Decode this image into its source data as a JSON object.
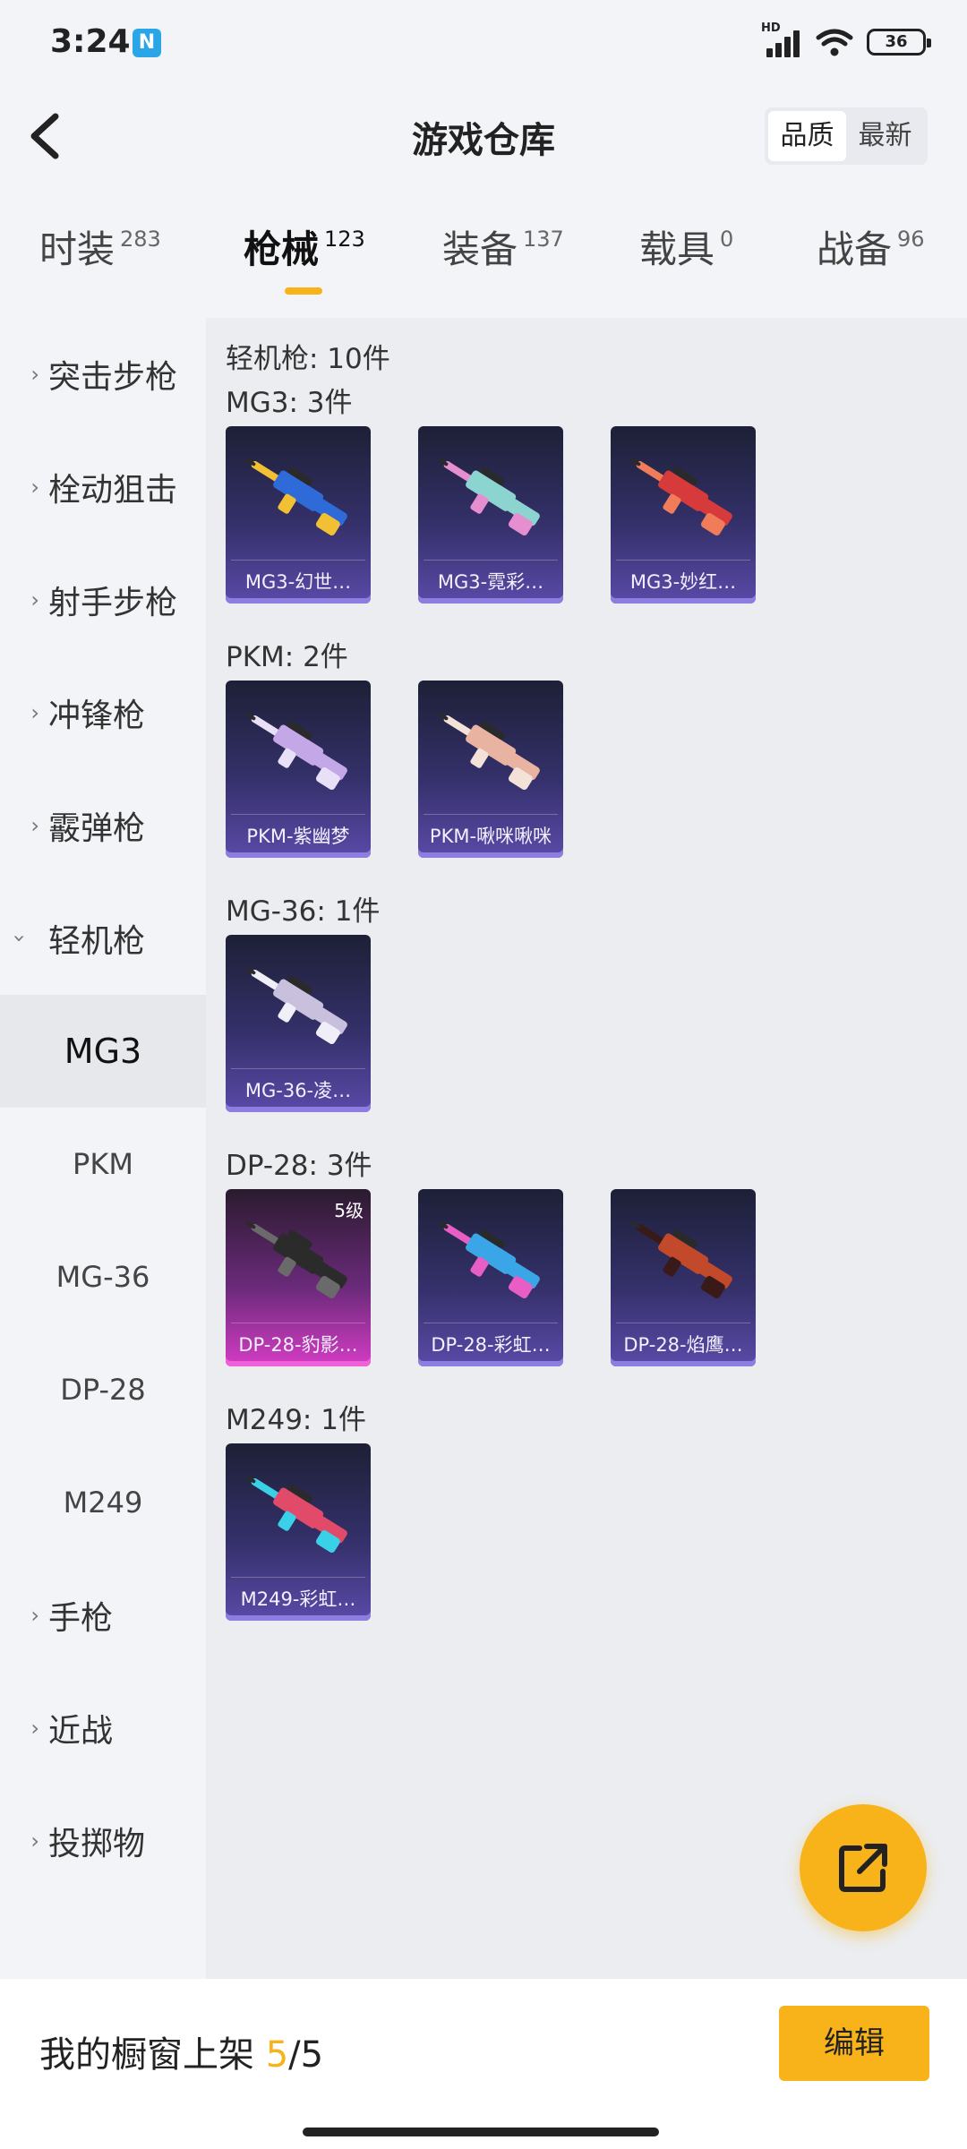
{
  "status_bar": {
    "time": "3:24",
    "battery": "36",
    "hd": "HD"
  },
  "header": {
    "title": "游戏仓库",
    "sort_options": [
      "品质",
      "最新"
    ],
    "active_sort": "品质"
  },
  "tabs": [
    {
      "label": "时装",
      "count": "283"
    },
    {
      "label": "枪械",
      "count": "123"
    },
    {
      "label": "装备",
      "count": "137"
    },
    {
      "label": "载具",
      "count": "0"
    },
    {
      "label": "战备",
      "count": "96"
    }
  ],
  "active_tab": "枪械",
  "sidebar": {
    "categories": [
      {
        "label": "突击步枪"
      },
      {
        "label": "栓动狙击"
      },
      {
        "label": "射手步枪"
      },
      {
        "label": "冲锋枪"
      },
      {
        "label": "霰弹枪"
      },
      {
        "label": "轻机枪"
      }
    ],
    "subitems": [
      "MG3",
      "PKM",
      "MG-36",
      "DP-28",
      "M249"
    ],
    "active_subitem": "MG3",
    "categories_after": [
      {
        "label": "手枪"
      },
      {
        "label": "近战"
      },
      {
        "label": "投掷物"
      }
    ]
  },
  "content": {
    "total": "轻机枪: 10件",
    "groups": [
      {
        "title": "MG3: 3件",
        "items": [
          {
            "label": "MG3-幻世…",
            "colors": [
              "#2f6bd8",
              "#f2c133"
            ]
          },
          {
            "label": "MG3-霓彩…",
            "colors": [
              "#8bd4d0",
              "#e58fd0"
            ]
          },
          {
            "label": "MG3-妙红…",
            "colors": [
              "#d63a3a",
              "#f07c5a"
            ]
          }
        ]
      },
      {
        "title": "PKM: 2件",
        "items": [
          {
            "label": "PKM-紫幽梦",
            "colors": [
              "#c4a7e6",
              "#e8e0f7"
            ]
          },
          {
            "label": "PKM-啾咪啾咪",
            "colors": [
              "#e8b3a0",
              "#f4e1d8"
            ]
          }
        ]
      },
      {
        "title": "MG-36: 1件",
        "items": [
          {
            "label": "MG-36-凌…",
            "colors": [
              "#c8c0dc",
              "#f0eef7"
            ]
          }
        ]
      },
      {
        "title": "DP-28: 3件",
        "items": [
          {
            "label": "DP-28-豹影…",
            "colors": [
              "#2b2b2b",
              "#6a6a6a"
            ],
            "level": "5级",
            "pink": true
          },
          {
            "label": "DP-28-彩虹…",
            "colors": [
              "#3aa6e8",
              "#e85ec4"
            ]
          },
          {
            "label": "DP-28-焰鹰…",
            "colors": [
              "#c24a2a",
              "#3a1a18"
            ]
          }
        ]
      },
      {
        "title": "M249: 1件",
        "items": [
          {
            "label": "M249-彩虹…",
            "colors": [
              "#e24a6a",
              "#3ad0e8"
            ]
          }
        ]
      }
    ]
  },
  "bottom": {
    "prefix": "我的橱窗上架 ",
    "current": "5",
    "suffix": "/5",
    "edit_label": "编辑"
  },
  "colors": {
    "accent": "#f7b319"
  }
}
